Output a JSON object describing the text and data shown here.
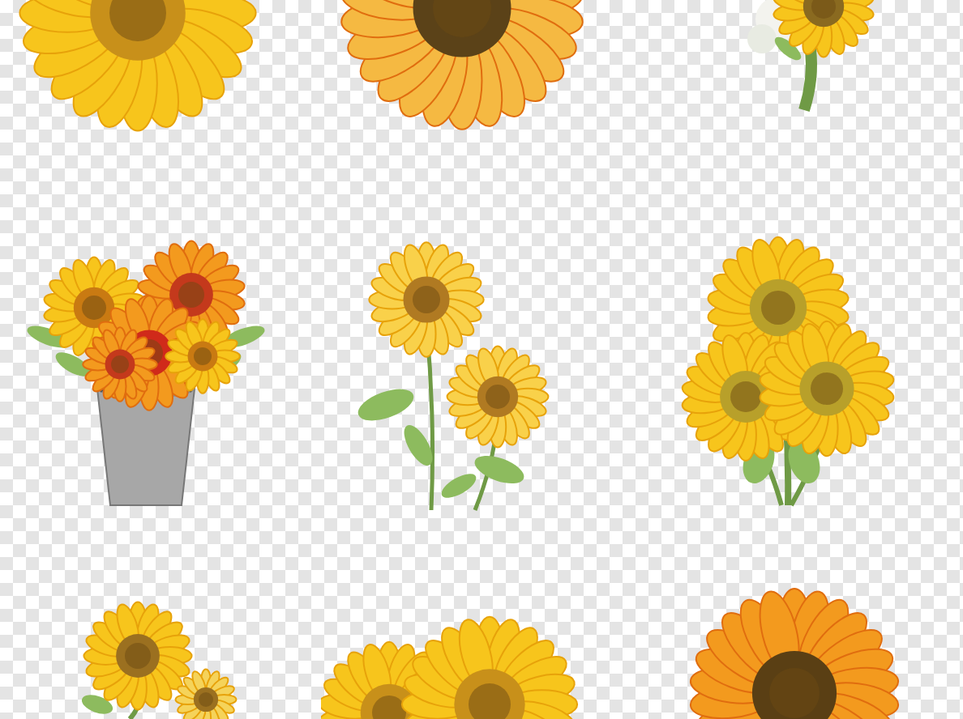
{
  "background": {
    "kind": "checkerboard"
  },
  "illustrations": [
    {
      "kind": "big-head"
    },
    {
      "kind": "orange-head"
    },
    {
      "kind": "white-bouquet"
    },
    {
      "kind": "bucket"
    },
    {
      "kind": "two-stems"
    },
    {
      "kind": "cluster"
    },
    {
      "kind": "small-spray"
    },
    {
      "kind": "head-row"
    },
    {
      "kind": "orange-head-low"
    }
  ]
}
